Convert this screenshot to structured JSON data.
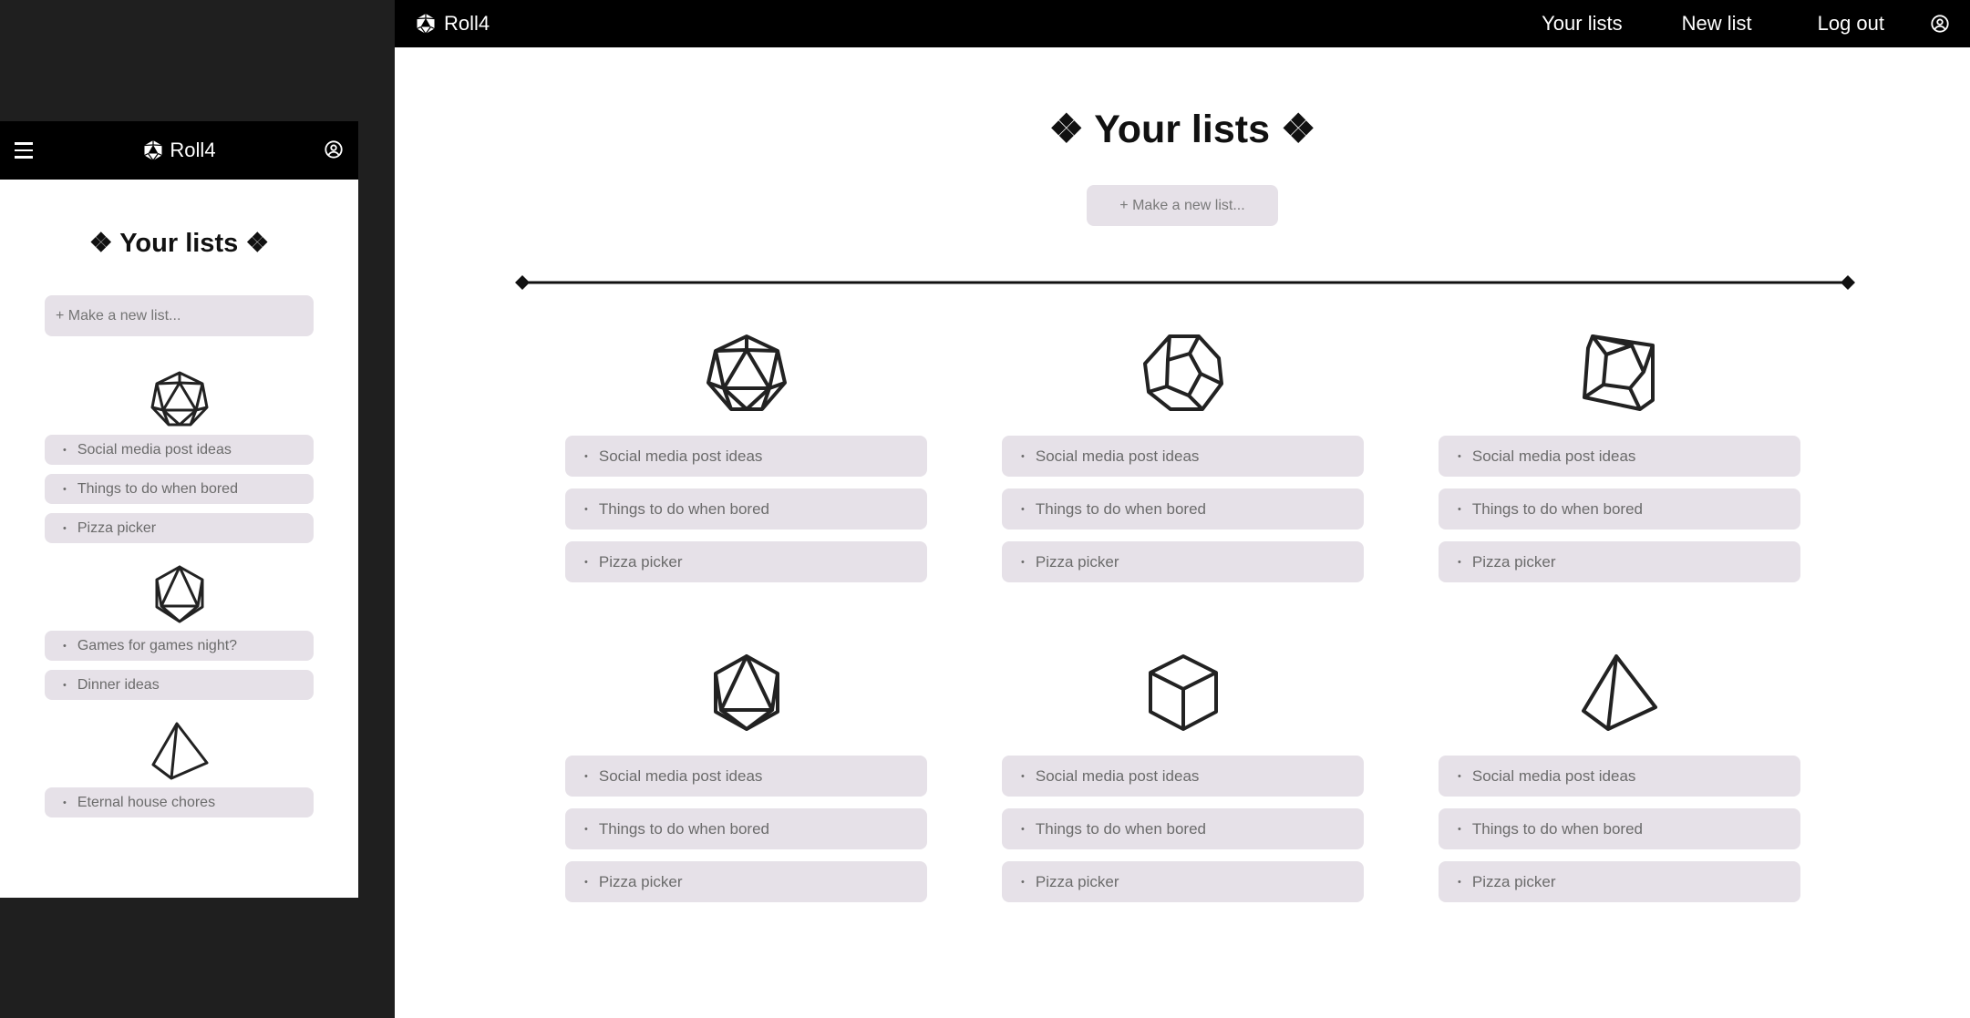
{
  "brand": {
    "name": "Roll4"
  },
  "nav": {
    "your_lists": "Your lists",
    "new_list": "New list",
    "log_out": "Log out"
  },
  "page": {
    "title": "❖ Your lists ❖",
    "new_list_placeholder": "+ Make a new list..."
  },
  "mobile": {
    "groups": [
      {
        "die": "d20-icon",
        "items": [
          "Social media post ideas",
          "Things to do when bored",
          "Pizza picker"
        ]
      },
      {
        "die": "d8-icon",
        "items": [
          "Games for games night?",
          "Dinner ideas"
        ]
      },
      {
        "die": "d4-icon",
        "items": [
          "Eternal house chores"
        ]
      }
    ]
  },
  "desktop": {
    "cards": [
      {
        "die": "d20-icon",
        "items": [
          "Social media post ideas",
          "Things to do when bored",
          "Pizza picker"
        ]
      },
      {
        "die": "d12-icon",
        "items": [
          "Social media post ideas",
          "Things to do when bored",
          "Pizza picker"
        ]
      },
      {
        "die": "d10-icon",
        "items": [
          "Social media post ideas",
          "Things to do when bored",
          "Pizza picker"
        ]
      },
      {
        "die": "d8-icon",
        "items": [
          "Social media post ideas",
          "Things to do when bored",
          "Pizza picker"
        ]
      },
      {
        "die": "d6-icon",
        "items": [
          "Social media post ideas",
          "Things to do when bored",
          "Pizza picker"
        ]
      },
      {
        "die": "d4-icon",
        "items": [
          "Social media post ideas",
          "Things to do when bored",
          "Pizza picker"
        ]
      }
    ]
  },
  "colors": {
    "bar": "#000000",
    "pill": "#e6e1e8",
    "backdrop": "#1f1f1f"
  }
}
